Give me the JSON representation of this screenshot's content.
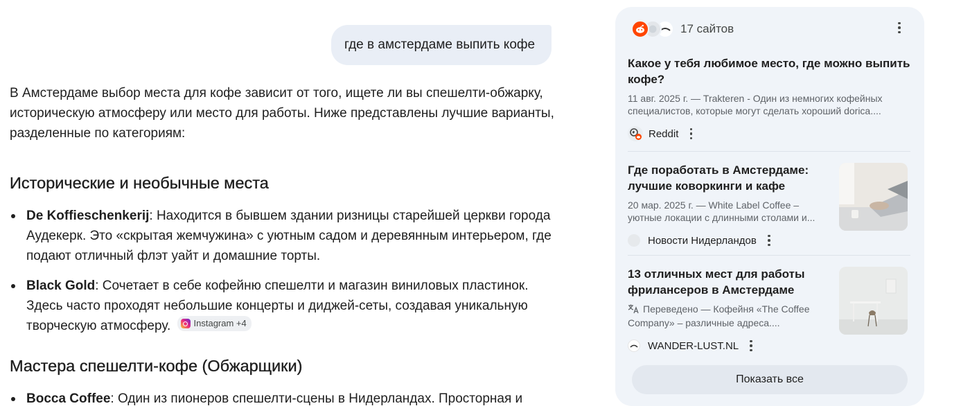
{
  "user_message": "где в амстердаме выпить кофе",
  "answer": {
    "intro": "В Амстердаме выбор места для кофе зависит от того, ищете ли вы спешелти-обжарку, историческую атмосферу или место для работы. Ниже представлены лучшие варианты, разделенные по категориям:",
    "sections": [
      {
        "heading": "Исторические и необычные места",
        "items": [
          {
            "name": "De Koffieschenkerij",
            "text": ": Находится в бывшем здании ризницы старейшей церкви города Аудекерк. Это «скрытая жемчужина» с уютным садом и деревянным интерьером, где подают отличный флэт уайт и домашние торты."
          },
          {
            "name": "Black Gold",
            "text": ": Сочетает в себе кофейню спешелти и магазин виниловых пластинок. Здесь часто проходят небольшие концерты и диджей-сеты, создавая уникальную творческую атмосферу.",
            "chip": "Instagram +4"
          }
        ]
      },
      {
        "heading": "Мастера спешелти-кофе (Обжарщики)",
        "items": [
          {
            "name": "Bocca Coffee",
            "text": ": Один из пионеров спешелти-сцены в Нидерландах. Просторная и"
          }
        ]
      }
    ]
  },
  "sources": {
    "count_label": "17 сайтов",
    "cards": [
      {
        "title": "Какое у тебя любимое место, где можно выпить кофе?",
        "snippet": "11 авг. 2025 г. — Trakteren - Один из немногих кофейных специалистов, которые могут сделать хороший dorica....",
        "source": "Reddit"
      },
      {
        "title": "Где поработать в Амстердаме: лучшие коворкинги и кафе",
        "snippet": "20 мар. 2025 г. — White Label Coffee – уютные локации с длинными столами и...",
        "source": "Новости Нидерландов"
      },
      {
        "title": "13 отличных мест для работы фрилансеров в Амстердаме",
        "snippet": "Переведено — Кофейня «The Coffee Company» – различные адреса....",
        "source": "WANDER-LUST.NL"
      }
    ],
    "show_all_label": "Показать все"
  },
  "colors": {
    "reddit": "#ff4500",
    "panel_bg": "#f0f4f9",
    "bubble_bg": "#e9eef6"
  }
}
